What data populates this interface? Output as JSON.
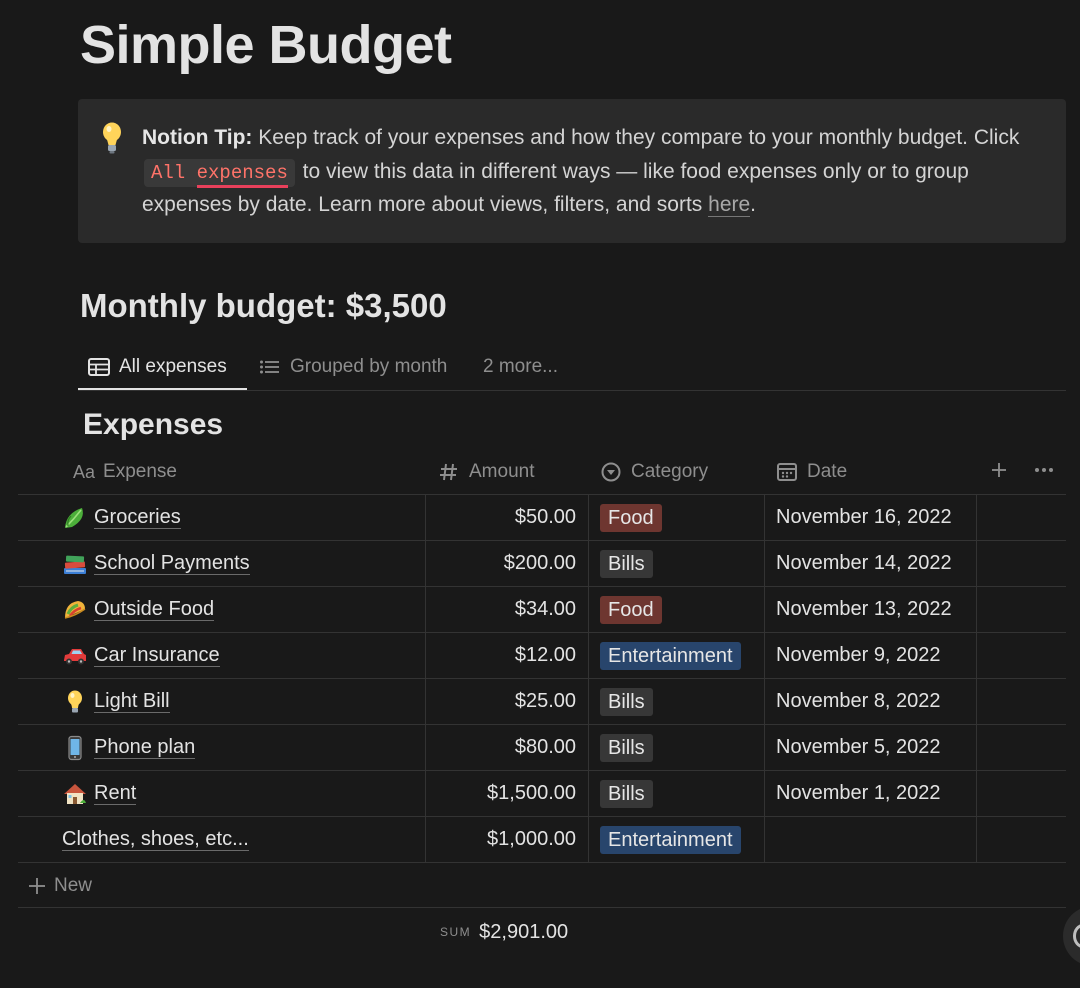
{
  "page": {
    "title": "Simple Budget"
  },
  "callout": {
    "icon": "lightbulb-icon",
    "bold_label": "Notion Tip:",
    "text_1": " Keep track of your expenses and how they compare to your monthly budget. Click ",
    "code_part_1": "All",
    "code_part_2": "expenses",
    "text_2": " to view this data in different ways — like food expenses only or to group expenses by date. Learn more about views, filters, and sorts ",
    "link_text": "here",
    "text_3": "."
  },
  "budget_heading": "Monthly budget: $3,500",
  "tabs": [
    {
      "label": "All expenses",
      "icon": "table-icon",
      "active": true
    },
    {
      "label": "Grouped by month",
      "icon": "list-icon",
      "active": false
    },
    {
      "label": "2 more...",
      "active": false
    }
  ],
  "database": {
    "title": "Expenses",
    "columns": [
      {
        "label": "Expense",
        "icon": "text-property-icon",
        "icon_text": "Aa"
      },
      {
        "label": "Amount",
        "icon": "number-property-icon"
      },
      {
        "label": "Category",
        "icon": "select-property-icon"
      },
      {
        "label": "Date",
        "icon": "calendar-icon"
      }
    ],
    "rows": [
      {
        "emoji": "leafy-green-icon",
        "name": "Groceries",
        "amount": "$50.00",
        "category": "Food",
        "category_color": "#6e3630",
        "date": "November 16, 2022"
      },
      {
        "emoji": "books-icon",
        "name": "School Payments",
        "amount": "$200.00",
        "category": "Bills",
        "category_color": "#373737",
        "date": "November 14, 2022"
      },
      {
        "emoji": "taco-icon",
        "name": "Outside Food",
        "amount": "$34.00",
        "category": "Food",
        "category_color": "#6e3630",
        "date": "November 13, 2022"
      },
      {
        "emoji": "car-icon",
        "name": "Car Insurance",
        "amount": "$12.00",
        "category": "Entertainment",
        "category_color": "#28456c",
        "date": "November 9, 2022"
      },
      {
        "emoji": "lightbulb-icon",
        "name": "Light Bill",
        "amount": "$25.00",
        "category": "Bills",
        "category_color": "#373737",
        "date": "November 8, 2022"
      },
      {
        "emoji": "mobile-phone-icon",
        "name": "Phone plan",
        "amount": "$80.00",
        "category": "Bills",
        "category_color": "#373737",
        "date": "November 5, 2022"
      },
      {
        "emoji": "house-icon",
        "name": "Rent",
        "amount": "$1,500.00",
        "category": "Bills",
        "category_color": "#373737",
        "date": "November 1, 2022"
      },
      {
        "emoji": "",
        "name": "Clothes, shoes, etc...",
        "amount": "$1,000.00",
        "category": "Entertainment",
        "category_color": "#28456c",
        "date": ""
      }
    ],
    "new_label": "New",
    "sum_label": "SUM",
    "sum_value": "$2,901.00"
  },
  "colors": {
    "background": "#191919",
    "callout_bg": "#2a2a2a",
    "code_text": "#ff7369",
    "code_underline": "#e8405b",
    "tag_food": "#6e3630",
    "tag_bills": "#373737",
    "tag_entertainment": "#28456c"
  }
}
